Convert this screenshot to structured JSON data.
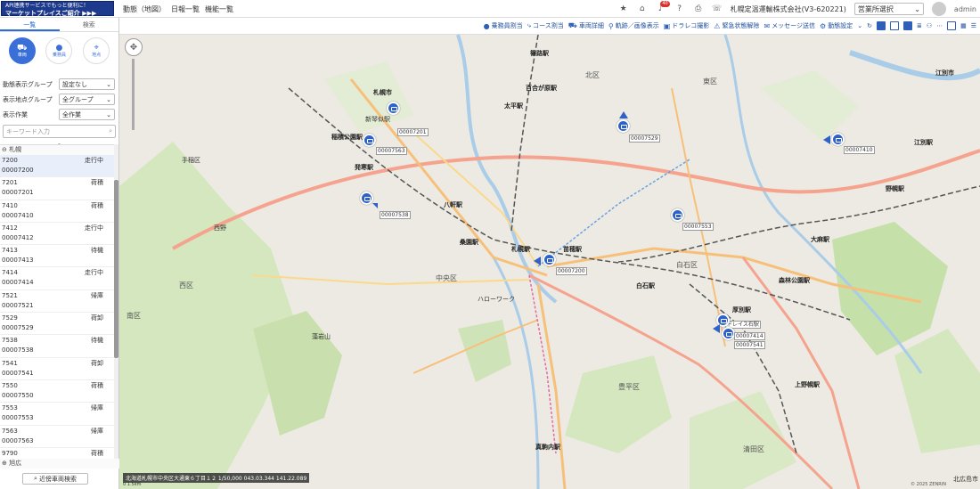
{
  "topbar": {
    "banner_line1": "API連携サービスでもっと便利に！",
    "banner_line2": "マーケットプレイスご紹介 ▶▶▶",
    "nav": [
      "動態（地図）",
      "日報一覧",
      "機能一覧"
    ],
    "company": "札幌定温運輸株式会社(V3-620221)",
    "office_select": "営業所選択",
    "user": "admin",
    "notification_count": "40"
  },
  "sidebar": {
    "tabs": [
      "一覧",
      "検索"
    ],
    "modes": [
      {
        "label": "車両",
        "icon": "truck-icon"
      },
      {
        "label": "乗務員",
        "icon": "person-icon"
      },
      {
        "label": "地点",
        "icon": "location-icon"
      }
    ],
    "filters": [
      {
        "label": "動態表示グループ",
        "value": "設定なし"
      },
      {
        "label": "表示地点グループ",
        "value": "全グループ"
      },
      {
        "label": "表示作業",
        "value": "全作業"
      }
    ],
    "keyword_placeholder": "キーワード入力",
    "group1": "札幌",
    "vehicles": [
      {
        "name": "7200",
        "id": "00007200",
        "status": "走行中"
      },
      {
        "name": "7201",
        "id": "00007201",
        "status": "荷積"
      },
      {
        "name": "7410",
        "id": "00007410",
        "status": "荷積"
      },
      {
        "name": "7412",
        "id": "00007412",
        "status": "走行中"
      },
      {
        "name": "7413",
        "id": "00007413",
        "status": "待機"
      },
      {
        "name": "7414",
        "id": "00007414",
        "status": "走行中"
      },
      {
        "name": "7521",
        "id": "00007521",
        "status": "帰庫"
      },
      {
        "name": "7529",
        "id": "00007529",
        "status": "荷卸"
      },
      {
        "name": "7538",
        "id": "00007538",
        "status": "待機"
      },
      {
        "name": "7541",
        "id": "00007541",
        "status": "荷卸"
      },
      {
        "name": "7550",
        "id": "00007550",
        "status": "荷積"
      },
      {
        "name": "7553",
        "id": "00007553",
        "status": "帰庫"
      },
      {
        "name": "7563",
        "id": "00007563",
        "status": "帰庫"
      },
      {
        "name": "9790",
        "id": "00009790",
        "status": "荷積"
      }
    ],
    "group2": "旭広",
    "near_button": "近傍車両検索"
  },
  "toolbar": {
    "buttons": [
      "乗務員割当",
      "コース割当",
      "車両詳細",
      "軌跡／画像表示",
      "ドラレコ撮影",
      "緊急状態解除",
      "メッセージ送信",
      "動態設定"
    ]
  },
  "map": {
    "places": [
      {
        "t": "篠路駅",
        "c": "b"
      },
      {
        "t": "北区",
        "c": "ward"
      },
      {
        "t": "東区",
        "c": "ward"
      },
      {
        "t": "札幌市",
        "c": "b"
      },
      {
        "t": "百合が原駅",
        "c": "b"
      },
      {
        "t": "太平駅",
        "c": "b"
      },
      {
        "t": "新琴似駅",
        "c": ""
      },
      {
        "t": "稲積公園駅",
        "c": "b"
      },
      {
        "t": "発寒駅",
        "c": "b"
      },
      {
        "t": "八軒駅",
        "c": "b"
      },
      {
        "t": "桑園駅",
        "c": "b"
      },
      {
        "t": "札幌駅",
        "c": "b"
      },
      {
        "t": "苗穂駅",
        "c": "b"
      },
      {
        "t": "白石区",
        "c": "ward"
      },
      {
        "t": "白石駅",
        "c": "b"
      },
      {
        "t": "森林公園駅",
        "c": "b"
      },
      {
        "t": "大麻駅",
        "c": "b"
      },
      {
        "t": "野幌駅",
        "c": "b"
      },
      {
        "t": "江別駅",
        "c": "b"
      },
      {
        "t": "厚別駅",
        "c": "b"
      },
      {
        "t": "西区",
        "c": "ward"
      },
      {
        "t": "中央区",
        "c": "ward"
      },
      {
        "t": "南区",
        "c": "ward"
      },
      {
        "t": "上野幌駅",
        "c": "b"
      },
      {
        "t": "真駒内駅",
        "c": "b"
      },
      {
        "t": "手稲区",
        "c": ""
      },
      {
        "t": "西野",
        "c": ""
      },
      {
        "t": "藻岩山",
        "c": ""
      },
      {
        "t": "ハローワーク",
        "c": ""
      },
      {
        "t": "豊平区",
        "c": "ward"
      },
      {
        "t": "清田区",
        "c": "ward"
      },
      {
        "t": "江別市",
        "c": "b"
      }
    ],
    "vehicle_labels": [
      "00007201",
      "00007563",
      "00007529",
      "00007410",
      "00007538",
      "00007553",
      "00007200",
      "00007414",
      "00007541"
    ],
    "popup": "ドレイス石駅",
    "scale_text": "北海道札幌市中央区大通東６丁目１２ 1/50,000 043.03.344 141.22.089",
    "scale_ruler": "0        1.5km",
    "copyright": "© 2025 ZENRIN",
    "corner_label": "北広島市"
  }
}
